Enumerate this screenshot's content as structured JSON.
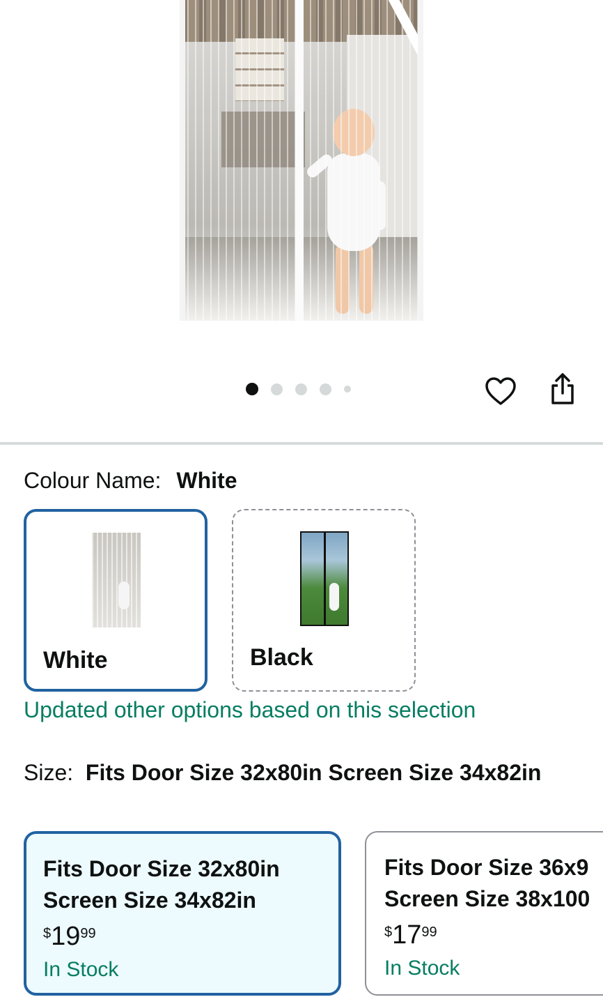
{
  "product": {
    "carousel": {
      "count": 5,
      "active_index": 0
    }
  },
  "colour": {
    "label": "Colour Name:",
    "selected_value": "White",
    "options": [
      {
        "name": "White",
        "selected": true
      },
      {
        "name": "Black",
        "selected": false
      }
    ],
    "notice": "Updated other options based on this selection"
  },
  "size": {
    "label": "Size:",
    "selected_value": "Fits Door Size 32x80in Screen Size 34x82in",
    "options": [
      {
        "line1": "Fits Door Size 32x80in",
        "line2": "Screen Size 34x82in",
        "price_symbol": "$",
        "price_whole": "19",
        "price_fraction": "99",
        "availability": "In Stock",
        "selected": true
      },
      {
        "line1": "Fits Door Size 36x9",
        "line2": "Screen Size 38x100",
        "price_symbol": "$",
        "price_whole": "17",
        "price_fraction": "99",
        "availability": "In Stock",
        "selected": false
      }
    ]
  },
  "colors": {
    "accent": "#2162a1",
    "success": "#067d62",
    "text": "#0f1111"
  }
}
